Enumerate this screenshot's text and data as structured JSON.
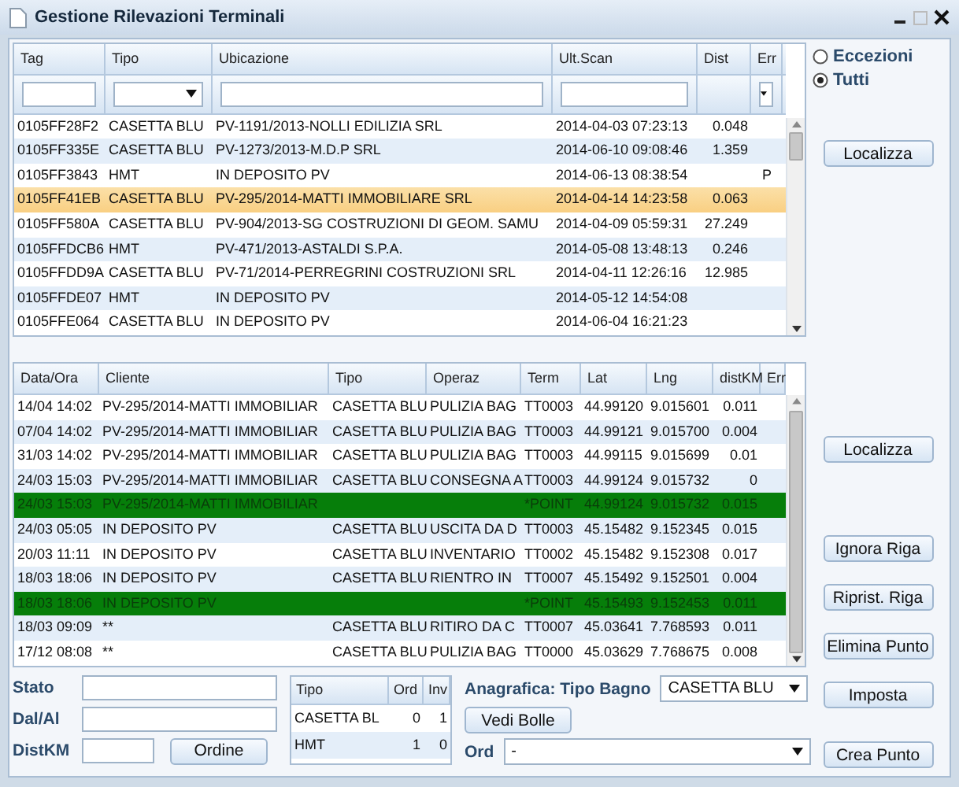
{
  "window": {
    "title": "Gestione Rilevazioni Terminali"
  },
  "terminals": {
    "columns": [
      "Tag",
      "Tipo",
      "Ubicazione",
      "Ult.Scan",
      "Dist",
      "Err"
    ],
    "rows": [
      {
        "tag": "0105FF28F2",
        "tipo": "CASETTA BLU",
        "ubicazione": "PV-1191/2013-NOLLI EDILIZIA SRL",
        "ult_scan": "2014-04-03 07:23:13",
        "dist": "0.048",
        "err": "",
        "selected": false
      },
      {
        "tag": "0105FF335E",
        "tipo": "CASETTA BLU",
        "ubicazione": "PV-1273/2013-M.D.P SRL",
        "ult_scan": "2014-06-10 09:08:46",
        "dist": "1.359",
        "err": "",
        "selected": false
      },
      {
        "tag": "0105FF3843",
        "tipo": "HMT",
        "ubicazione": "IN DEPOSITO PV",
        "ult_scan": "2014-06-13 08:38:54",
        "dist": "",
        "err": "P",
        "selected": false
      },
      {
        "tag": "0105FF41EB",
        "tipo": "CASETTA BLU",
        "ubicazione": "PV-295/2014-MATTI IMMOBILIARE SRL",
        "ult_scan": "2014-04-14 14:23:58",
        "dist": "0.063",
        "err": "",
        "selected": true
      },
      {
        "tag": "0105FF580A",
        "tipo": "CASETTA BLU",
        "ubicazione": "PV-904/2013-SG COSTRUZIONI DI GEOM. SAMU",
        "ult_scan": "2014-04-09 05:59:31",
        "dist": "27.249",
        "err": "",
        "selected": false
      },
      {
        "tag": "0105FFDCB6",
        "tipo": "HMT",
        "ubicazione": "PV-471/2013-ASTALDI S.P.A.",
        "ult_scan": "2014-05-08 13:48:13",
        "dist": "0.246",
        "err": "",
        "selected": false
      },
      {
        "tag": "0105FFDD9A",
        "tipo": "CASETTA BLU",
        "ubicazione": "PV-71/2014-PERREGRINI COSTRUZIONI SRL",
        "ult_scan": "2014-04-11 12:26:16",
        "dist": "12.985",
        "err": "",
        "selected": false
      },
      {
        "tag": "0105FFDE07",
        "tipo": "HMT",
        "ubicazione": "IN DEPOSITO PV",
        "ult_scan": "2014-05-12 14:54:08",
        "dist": "",
        "err": "",
        "selected": false
      },
      {
        "tag": "0105FFE064",
        "tipo": "CASETTA BLU",
        "ubicazione": "IN DEPOSITO PV",
        "ult_scan": "2014-06-04 16:21:23",
        "dist": "",
        "err": "",
        "selected": false
      }
    ]
  },
  "filter": {
    "options": [
      {
        "label": "Eccezioni",
        "selected": false
      },
      {
        "label": "Tutti",
        "selected": true
      }
    ]
  },
  "scans": {
    "columns": [
      "Data/Ora",
      "Cliente",
      "Tipo",
      "Operaz",
      "Term",
      "Lat",
      "Lng",
      "distKM",
      "Err"
    ],
    "rows": [
      {
        "kind": "record",
        "data": "14/04 14:02",
        "cliente": "PV-295/2014-MATTI IMMOBILIAR",
        "tipo": "CASETTA BLU",
        "operaz": "PULIZIA BAG",
        "term": "TT0003",
        "lat": "44.99120",
        "lng": "9.015601",
        "distkm": "0.011"
      },
      {
        "kind": "record",
        "data": "07/04 14:02",
        "cliente": "PV-295/2014-MATTI IMMOBILIAR",
        "tipo": "CASETTA BLU",
        "operaz": "PULIZIA BAG",
        "term": "TT0003",
        "lat": "44.99121",
        "lng": "9.015700",
        "distkm": "0.004"
      },
      {
        "kind": "record",
        "data": "31/03 14:02",
        "cliente": "PV-295/2014-MATTI IMMOBILIAR",
        "tipo": "CASETTA BLU",
        "operaz": "PULIZIA BAG",
        "term": "TT0003",
        "lat": "44.99115",
        "lng": "9.015699",
        "distkm": "0.01"
      },
      {
        "kind": "record",
        "data": "24/03 15:03",
        "cliente": "PV-295/2014-MATTI IMMOBILIAR",
        "tipo": "CASETTA BLU",
        "operaz": "CONSEGNA A",
        "term": "TT0003",
        "lat": "44.99124",
        "lng": "9.015732",
        "distkm": "0"
      },
      {
        "kind": "point",
        "data": "24/03 15:03",
        "cliente": "PV-295/2014-MATTI IMMOBILIAR",
        "tipo": "",
        "operaz": "",
        "term": "*POINT",
        "lat": "44.99124",
        "lng": "9.015732",
        "distkm": "0.015"
      },
      {
        "kind": "record",
        "data": "24/03 05:05",
        "cliente": "IN DEPOSITO PV",
        "tipo": "CASETTA BLU",
        "operaz": "USCITA DA D",
        "term": "TT0003",
        "lat": "45.15482",
        "lng": "9.152345",
        "distkm": "0.015"
      },
      {
        "kind": "record",
        "data": "20/03 11:11",
        "cliente": "IN DEPOSITO PV",
        "tipo": "CASETTA BLU",
        "operaz": "INVENTARIO",
        "term": "TT0002",
        "lat": "45.15482",
        "lng": "9.152308",
        "distkm": "0.017"
      },
      {
        "kind": "record",
        "data": "18/03 18:06",
        "cliente": "IN DEPOSITO PV",
        "tipo": "CASETTA BLU",
        "operaz": "RIENTRO IN",
        "term": "TT0007",
        "lat": "45.15492",
        "lng": "9.152501",
        "distkm": "0.004"
      },
      {
        "kind": "point",
        "data": "18/03 18:06",
        "cliente": "IN DEPOSITO PV",
        "tipo": "",
        "operaz": "",
        "term": "*POINT",
        "lat": "45.15493",
        "lng": "9.152453",
        "distkm": "0.011"
      },
      {
        "kind": "record",
        "data": "18/03 09:09",
        "cliente": "**",
        "tipo": "CASETTA BLU",
        "operaz": "RITIRO DA C",
        "term": "TT0007",
        "lat": "45.03641",
        "lng": "7.768593",
        "distkm": "0.011"
      },
      {
        "kind": "record",
        "data": "17/12 08:08",
        "cliente": "**",
        "tipo": "CASETTA BLU",
        "operaz": "PULIZIA BAG",
        "term": "TT0000",
        "lat": "45.03629",
        "lng": "7.768675",
        "distkm": "0.008"
      }
    ]
  },
  "form": {
    "fields": [
      "Stato",
      "Dal/Al",
      "DistKM"
    ],
    "order_button": "Ordine",
    "summary": {
      "columns": [
        "Tipo",
        "Ord",
        "Inv"
      ],
      "rows": [
        {
          "tipo": "CASETTA BL",
          "ord": "0",
          "inv": "1"
        },
        {
          "tipo": "HMT",
          "ord": "1",
          "inv": "0"
        }
      ]
    },
    "anagrafica_label": "Anagrafica: Tipo Bagno",
    "anagrafica_value": "CASETTA BLU",
    "bolle_button": "Vedi Bolle",
    "ord_label": "Ord",
    "ord_value": "-"
  },
  "side_buttons": [
    "Localizza",
    "Localizza",
    "Ignora Riga",
    "Riprist. Riga",
    "Elimina Punto",
    "Imposta",
    "Crea Punto"
  ]
}
